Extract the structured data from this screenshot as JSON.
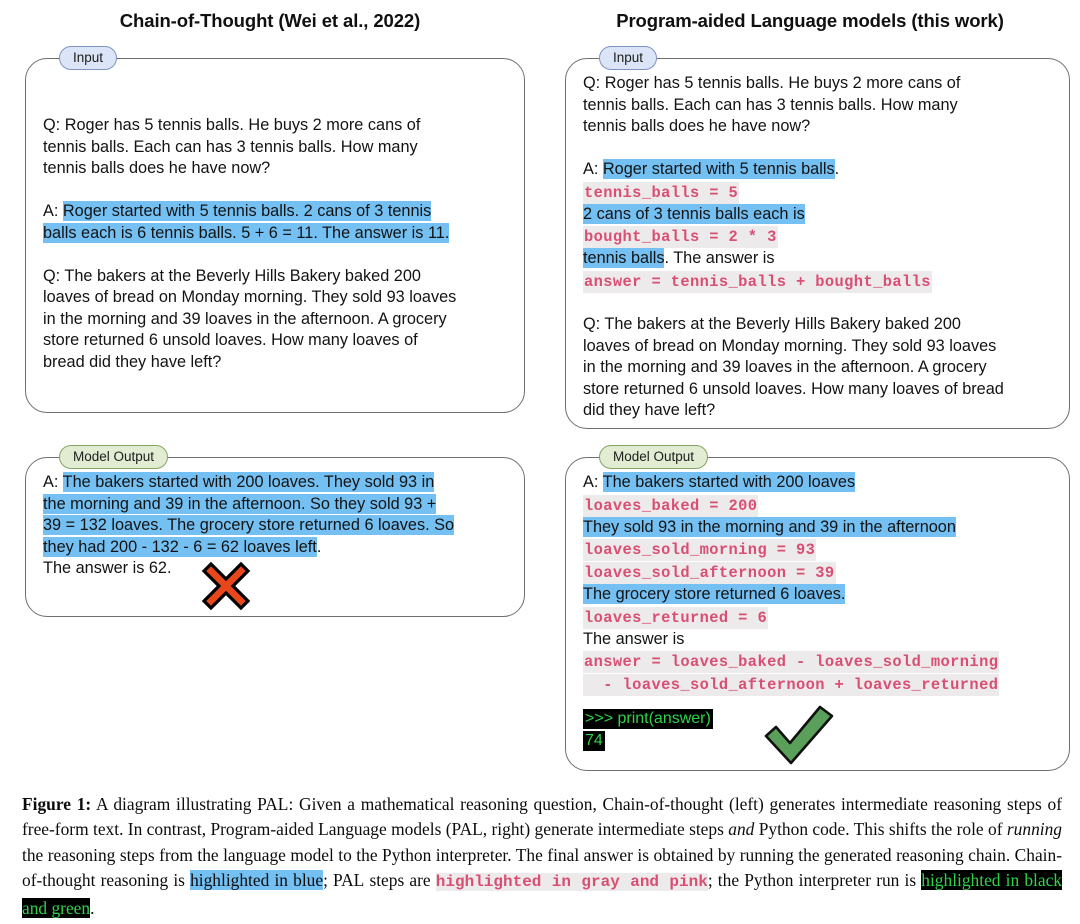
{
  "titles": {
    "left": "Chain-of-Thought (Wei et al., 2022)",
    "right": "Program-aided Language models (this work)"
  },
  "badges": {
    "input": "Input",
    "model_output": "Model Output"
  },
  "colors": {
    "highlight_blue": "#74c0f3",
    "code_pink": "#d94f73",
    "code_gray_bg": "#eceaea",
    "terminal_black": "#000000",
    "terminal_green": "#2fd24a",
    "badge_input_bg": "#dbe5f7",
    "badge_output_bg": "#e1ecd3",
    "cross_red": "#e8471c",
    "check_green": "#5aa05a"
  },
  "cot": {
    "input": {
      "q1_lines": [
        "Q: Roger has 5 tennis balls. He buys 2 more cans of",
        "tennis balls. Each can has 3 tennis balls. How many",
        "tennis balls does he have now?"
      ],
      "a1_prefix": "A: ",
      "a1_highlight_line1": "Roger started with 5 tennis balls. 2 cans of 3 tennis",
      "a1_highlight_line2": "balls each is 6 tennis balls. 5 + 6 = 11. The answer is 11.",
      "q2_lines": [
        "Q: The bakers at the Beverly Hills Bakery baked 200",
        "loaves of bread on Monday morning. They sold 93 loaves",
        "in the morning and 39 loaves in the afternoon. A grocery",
        "store returned 6 unsold loaves. How many loaves of",
        "bread did they have left?"
      ]
    },
    "output": {
      "a_prefix": "A: ",
      "hl_line1": "The bakers started with 200 loaves. They sold 93 in",
      "hl_line2": "the morning and 39 in the afternoon. So they sold 93 +",
      "hl_line3": "39 = 132 loaves. The grocery store returned 6 loaves. So",
      "hl_line4": "they had 200 - 132 - 6 = 62 loaves left",
      "hl_line4_tail": ".",
      "final_line": "The answer is 62.",
      "verdict": "cross"
    }
  },
  "pal": {
    "input": {
      "q1_lines": [
        "Q: Roger has 5 tennis balls. He buys 2 more cans of",
        "tennis balls. Each can has 3 tennis balls. How many",
        "tennis balls does he have now?"
      ],
      "a1_prefix": "A: ",
      "a1_hl1": "Roger started with 5 tennis balls",
      "a1_hl1_tail": ".",
      "a1_code1": "tennis_balls = 5",
      "a1_hl2": "2 cans of 3 tennis balls each is",
      "a1_code2": "bought_balls = 2 * 3",
      "a1_hl3": "tennis balls",
      "a1_hl3_tail": ". The answer is",
      "a1_code3": "answer = tennis_balls + bought_balls",
      "q2_lines": [
        "Q: The bakers at the Beverly Hills Bakery baked 200",
        "loaves of bread on Monday morning. They sold 93 loaves",
        "in the morning and 39 loaves in the afternoon. A grocery",
        "store returned 6 unsold loaves. How many loaves of bread",
        "did they have left?"
      ]
    },
    "output": {
      "a_prefix": "A: ",
      "hl1": "The bakers started with 200 loaves",
      "code1": "loaves_baked = 200",
      "hl2": "They sold 93 in the morning and 39 in the afternoon",
      "code2": "loaves_sold_morning = 93",
      "code3": "loaves_sold_afternoon = 39",
      "hl3": "The grocery store returned 6 loaves.",
      "code4": "loaves_returned = 6",
      "plain": "The answer is",
      "code5": "answer = loaves_baked - loaves_sold_morning",
      "code6": "  - loaves_sold_afternoon + loaves_returned",
      "terminal_cmd": ">>> print(answer)",
      "terminal_result": "74",
      "verdict": "check"
    }
  },
  "caption": {
    "label": "Figure 1:",
    "t1": " A diagram illustrating ",
    "pal1": "PAL",
    "t2": ": Given a mathematical reasoning question, Chain-of-thought (left) generates intermediate reasoning steps of free-form text. In contrast, Program-aided Language models (",
    "pal2": "PAL",
    "t3": ", right) generate intermediate steps ",
    "i1": "and",
    "t4": " Python code. This shifts the role of ",
    "i2": "running",
    "t5": " the reasoning steps from the language model to the Python interpreter. The final answer is obtained by running the generated reasoning chain. Chain-of-thought reasoning is ",
    "hl_blue": "highlighted in blue",
    "t6": "; ",
    "pal3": "PAL",
    "t7": " steps are ",
    "hl_pink": "highlighted in gray and pink",
    "t8": "; the Python interpreter run is ",
    "hl_term": "highlighted in black and green",
    "t9": "."
  }
}
